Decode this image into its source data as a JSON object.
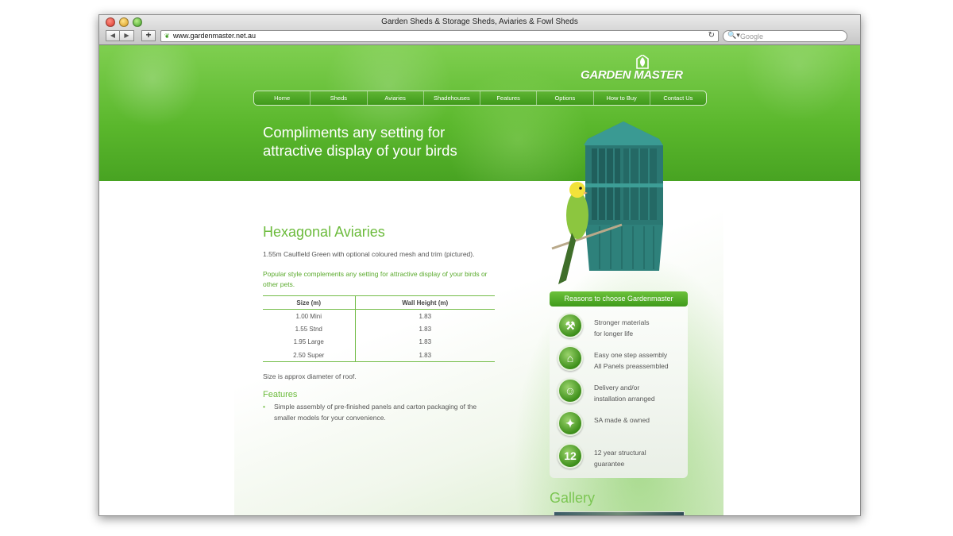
{
  "browser": {
    "window_title": "Garden Sheds & Storage Sheds, Aviaries & Fowl Sheds",
    "back_label": "◀",
    "forward_label": "▶",
    "add_label": "+",
    "url": "www.gardenmaster.net.au",
    "search_placeholder": "Google"
  },
  "site": {
    "logo_text": "GARDEN MASTER",
    "nav": [
      "Home",
      "Sheds",
      "Aviaries",
      "Shadehouses",
      "Features",
      "Options",
      "How to Buy",
      "Contact Us"
    ],
    "tagline_line1": "Compliments any setting for",
    "tagline_line2": "attractive display of your birds"
  },
  "main": {
    "title": "Hexagonal Aviaries",
    "para1": "1.55m Caulfield Green with optional coloured mesh and trim (pictured).",
    "para2": "Popular style complements any setting for attractive display of your birds or other pets.",
    "table": {
      "headers": [
        "Size (m)",
        "Wall Height (m)"
      ],
      "rows": [
        [
          "1.00 Mini",
          "1.83"
        ],
        [
          "1.55 Stnd",
          "1.83"
        ],
        [
          "1.95 Large",
          "1.83"
        ],
        [
          "2.50 Super",
          "1.83"
        ]
      ]
    },
    "note": "Size is approx diameter of roof.",
    "features_title": "Features",
    "features": [
      "Simple assembly of pre-finished panels and carton packaging of the smaller models for your convenience."
    ]
  },
  "sidebar": {
    "reasons_title": "Reasons to choose Gardenmaster",
    "reasons": [
      {
        "icon": "tools-icon",
        "line1": "Stronger materials",
        "line2": "for longer life"
      },
      {
        "icon": "shed-icon",
        "line1": "Easy one step assembly",
        "line2": "All Panels preassembled"
      },
      {
        "icon": "worker-icon",
        "line1": "Delivery and/or",
        "line2": "installation arranged"
      },
      {
        "icon": "sa-badge-icon",
        "line1": "SA made & owned",
        "line2": ""
      },
      {
        "icon": "guarantee-badge-icon",
        "badge_number": "12",
        "line1": "12 year structural",
        "line2": "guarantee"
      }
    ],
    "gallery_title": "Gallery"
  },
  "colors": {
    "brand_green": "#5ab72c",
    "text_green": "#6cbb3c",
    "aviary_teal": "#2f7f7a"
  }
}
